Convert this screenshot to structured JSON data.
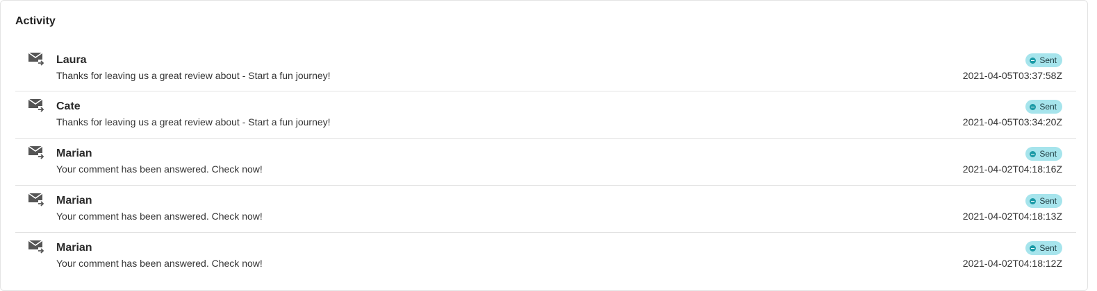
{
  "panel": {
    "title": "Activity"
  },
  "activity": {
    "items": [
      {
        "name": "Laura",
        "message": "Thanks for leaving us a great review about - Start a fun journey!",
        "status": "Sent",
        "timestamp": "2021-04-05T03:37:58Z",
        "icon": "mail-send-icon"
      },
      {
        "name": "Cate",
        "message": "Thanks for leaving us a great review about - Start a fun journey!",
        "status": "Sent",
        "timestamp": "2021-04-05T03:34:20Z",
        "icon": "mail-send-icon"
      },
      {
        "name": "Marian",
        "message": "Your comment has been answered. Check now!",
        "status": "Sent",
        "timestamp": "2021-04-02T04:18:16Z",
        "icon": "mail-send-icon"
      },
      {
        "name": "Marian",
        "message": "Your comment has been answered. Check now!",
        "status": "Sent",
        "timestamp": "2021-04-02T04:18:13Z",
        "icon": "mail-send-icon"
      },
      {
        "name": "Marian",
        "message": "Your comment has been answered. Check now!",
        "status": "Sent",
        "timestamp": "2021-04-02T04:18:12Z",
        "icon": "mail-send-icon"
      }
    ]
  },
  "colors": {
    "badge_background": "#a6e4ec",
    "badge_dot": "#1b9aa6",
    "divider": "#e2e2e2"
  }
}
